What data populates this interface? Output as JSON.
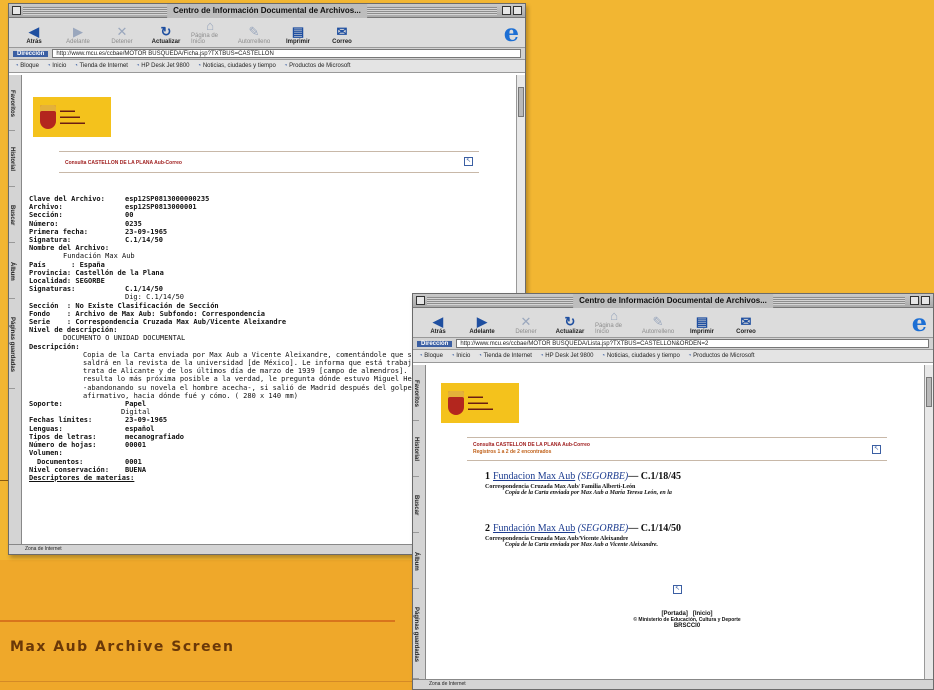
{
  "caption": "Max Aub Archive Screen",
  "colors": {
    "background": "#f2b632",
    "caption_text": "#6a3808",
    "link": "#1b3b8f",
    "logo_yellow": "#f4c21c"
  },
  "window1": {
    "title": "Centro de Información Documental de Archivos...",
    "toolbar": [
      {
        "label": "Atrás",
        "icon": "back-arrow-icon",
        "enabled": true
      },
      {
        "label": "Adelante",
        "icon": "forward-arrow-icon",
        "enabled": false
      },
      {
        "label": "Detener",
        "icon": "stop-icon",
        "enabled": false
      },
      {
        "label": "Actualizar",
        "icon": "refresh-icon",
        "enabled": true
      },
      {
        "label": "Página de Inicio",
        "icon": "home-icon",
        "enabled": false
      },
      {
        "label": "Autorrelleno",
        "icon": "autofill-icon",
        "enabled": false
      },
      {
        "label": "Imprimir",
        "icon": "print-icon",
        "enabled": true
      },
      {
        "label": "Correo",
        "icon": "mail-icon",
        "enabled": true
      }
    ],
    "address_label": "Dirección",
    "url": "http://www.mcu.es/ccbae/MOTOR BUSQUEDA/Ficha.jsp?TXTBUS=CASTELLON",
    "favorites": [
      "Bloque",
      "Inicio",
      "Tienda de Internet",
      "HP Desk Jet 9800",
      "Noticias, ciudades y tiempo",
      "Productos de Microsoft"
    ],
    "sidetabs": [
      "Favoritos",
      "Historial",
      "Buscar",
      "Álbum",
      "Páginas guardadas"
    ],
    "headline": "Consulta CASTELLON DE LA PLANA Aub-Correo",
    "record": {
      "clave_label": "Clave del Archivo:",
      "clave": "esp12SP0813000000235",
      "archivo_label": "Archivo:",
      "archivo": "esp12SP0813000001",
      "seccion_label": "Sección:",
      "seccion": "00",
      "numero_label": "Número:",
      "numero": "0235",
      "fecha_label": "Primera fecha:",
      "fecha": "23-09-1965",
      "signatura_label": "Signatura:",
      "signatura": "C.1/14/50",
      "nombre_label": "Nombre del Archivo:",
      "nombre": "Fundación Max Aub",
      "pais": "País      : España",
      "provincia": "Provincia: Castellón de la Plana",
      "localidad": "Localidad: SEGORBE",
      "signaturas_label": "Signaturas:",
      "signaturas": "C.1/14/50",
      "dig": "Dig: C.1/14/50",
      "seccion2": "Sección  : No Existe Clasificación de Sección",
      "fondo": "Fondo    : Archivo de Max Aub: Subfondo: Correspondencia",
      "serie": "Serie    : Correspondencia Cruzada Max Aub/Vicente Aleixandre",
      "nivel_label": "Nivel de descripción:",
      "nivel": "DOCUMENTO O UNIDAD DOCUMENTAL",
      "descripcion_label": "Descripción:",
      "descripcion": "Copia de la Carta enviada por Max Aub a Vicente Aleixandre, comentándole que su poema [en la ciudad] saldrá en la revista de la universidad [de México]. Le informa que está trabajando en una novela que trata de Alicante y de los últimos día de marzo de 1939 [campo de almendros]. Pero que esta novela resulta lo más próxima posible a la verdad, le pregunta dónde estuvo Miguel Hernández aquellos días, -abandonando su novela el hombre acecha-, si salió de Madrid después del golpe de Casado y en caso afirmativo, hacia dónde fué y cómo. ( 280 x 140 mm)",
      "soporte_label": "Soporte:",
      "soporte": "Papel",
      "soporte2": "Digital",
      "limites_label": "Fechas límites:",
      "limites": "23-09-1965",
      "lenguas_label": "Lenguas:",
      "lenguas": "español",
      "letras_label": "Tipos de letras:",
      "letras": "mecanografiado",
      "hojas_label": "Número de hojas:",
      "hojas": "00001",
      "volumen_label": "Volumen:",
      "documentos_label": "Documentos:",
      "documentos": "0001",
      "conservacion_label": "Nivel conservación:",
      "conservacion": "BUENA",
      "materias_label": "Descriptores de materias:"
    },
    "status": "Zona de Internet"
  },
  "window2": {
    "title": "Centro de Información Documental de Archivos...",
    "toolbar": [
      {
        "label": "Atrás",
        "icon": "back-arrow-icon",
        "enabled": true
      },
      {
        "label": "Adelante",
        "icon": "forward-arrow-icon",
        "enabled": true
      },
      {
        "label": "Detener",
        "icon": "stop-icon",
        "enabled": false
      },
      {
        "label": "Actualizar",
        "icon": "refresh-icon",
        "enabled": true
      },
      {
        "label": "Página de Inicio",
        "icon": "home-icon",
        "enabled": false
      },
      {
        "label": "Autorrelleno",
        "icon": "autofill-icon",
        "enabled": false
      },
      {
        "label": "Imprimir",
        "icon": "print-icon",
        "enabled": true
      },
      {
        "label": "Correo",
        "icon": "mail-icon",
        "enabled": true
      }
    ],
    "address_label": "Dirección",
    "url": "http://www.mcu.es/ccbae/MOTOR BUSQUEDA/Lista.jsp?TXTBUS=CASTELLON&ORDEN=2",
    "favorites": [
      "Bloque",
      "Inicio",
      "Tienda de Internet",
      "HP Desk Jet 9800",
      "Noticias, ciudades y tiempo",
      "Productos de Microsoft"
    ],
    "sidetabs": [
      "Favoritos",
      "Historial",
      "Buscar",
      "Álbum",
      "Páginas guardadas"
    ],
    "headline": "Consulta CASTELLON DE LA PLANA Aub-Correo",
    "subheadline": "Registros 1 a 2 de 2 encontrados",
    "results": [
      {
        "num": "1",
        "title": "Fundacion Max Aub",
        "place": "(SEGORBE)",
        "sig": "C.1/18/45",
        "desc": "Correspondencia Cruzada Max Aub/ Familia Alberti-León",
        "desc2": "Copia de la Carta enviada por Max Aub a María Teresa León, en la"
      },
      {
        "num": "2",
        "title": "Fundación Max Aub",
        "place": "(SEGORBE)",
        "sig": "C.1/14/50",
        "desc": "Correspondencia Cruzada Max Aub/Vicente Aleixandre",
        "desc2": "Copia de la Carta enviada por Max Aub a Vicente Aleixandre."
      }
    ],
    "footer_links": [
      "[Portada]",
      "[Inicio]"
    ],
    "copyright": "© Ministerio de Educación, Cultura y Deporte",
    "footer_code": "BRSCCI0",
    "status": "Zona de Internet"
  }
}
